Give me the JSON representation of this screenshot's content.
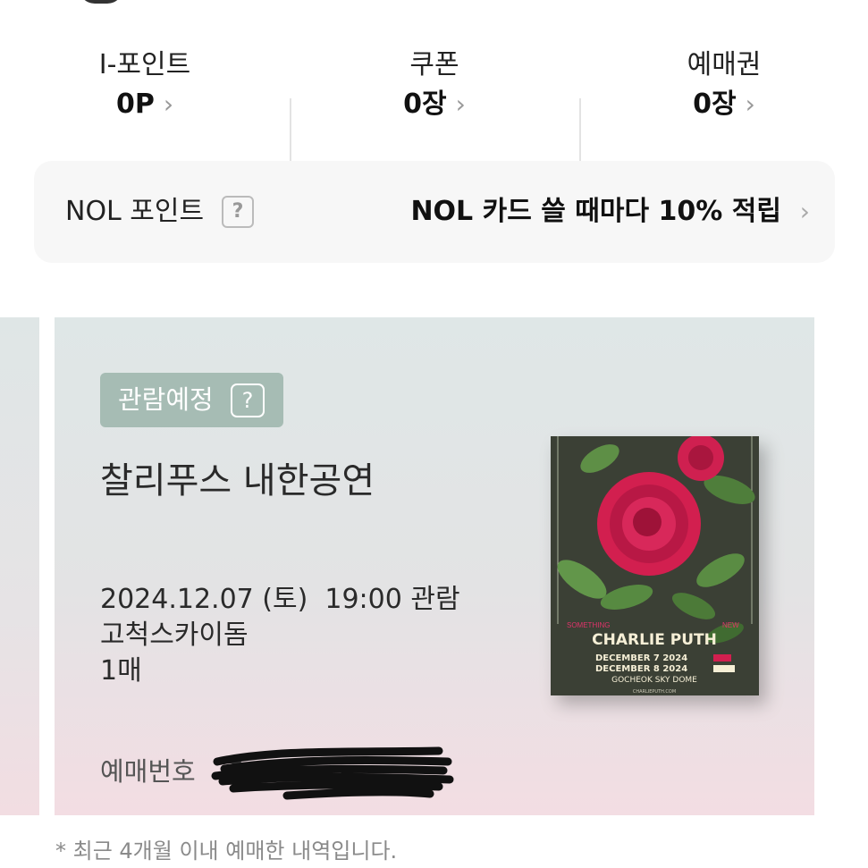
{
  "stats": [
    {
      "label": "I-포인트",
      "value": "0P"
    },
    {
      "label": "쿠폰",
      "value": "0장"
    },
    {
      "label": "예매권",
      "value": "0장"
    }
  ],
  "nol": {
    "label": "NOL 포인트",
    "help": "?",
    "promo": "NOL 카드 쓸 때마다 10% 적립"
  },
  "ticket": {
    "badge": "관람예정",
    "badge_help": "?",
    "title": "찰리푸스 내한공연",
    "datetime": "2024.12.07 (토)  19:00 관람",
    "venue": "고척스카이돔",
    "count": "1매",
    "booking_label": "예매번호",
    "booking_value": "T"
  },
  "poster": {
    "tag_left": "SOMETHING",
    "tag_right": "NEW",
    "artist": "CHARLIE PUTH",
    "date1": "DECEMBER 7 2024",
    "date2": "DECEMBER 8 2024",
    "venue": "GOCHEOK SKY DOME",
    "website": "CHARLIEPUTH.COM"
  },
  "footnote": "* 최근 4개월 이내 예매한 내역입니다.",
  "icons": {
    "chevron": "chevron-right-icon",
    "help": "question-icon"
  }
}
